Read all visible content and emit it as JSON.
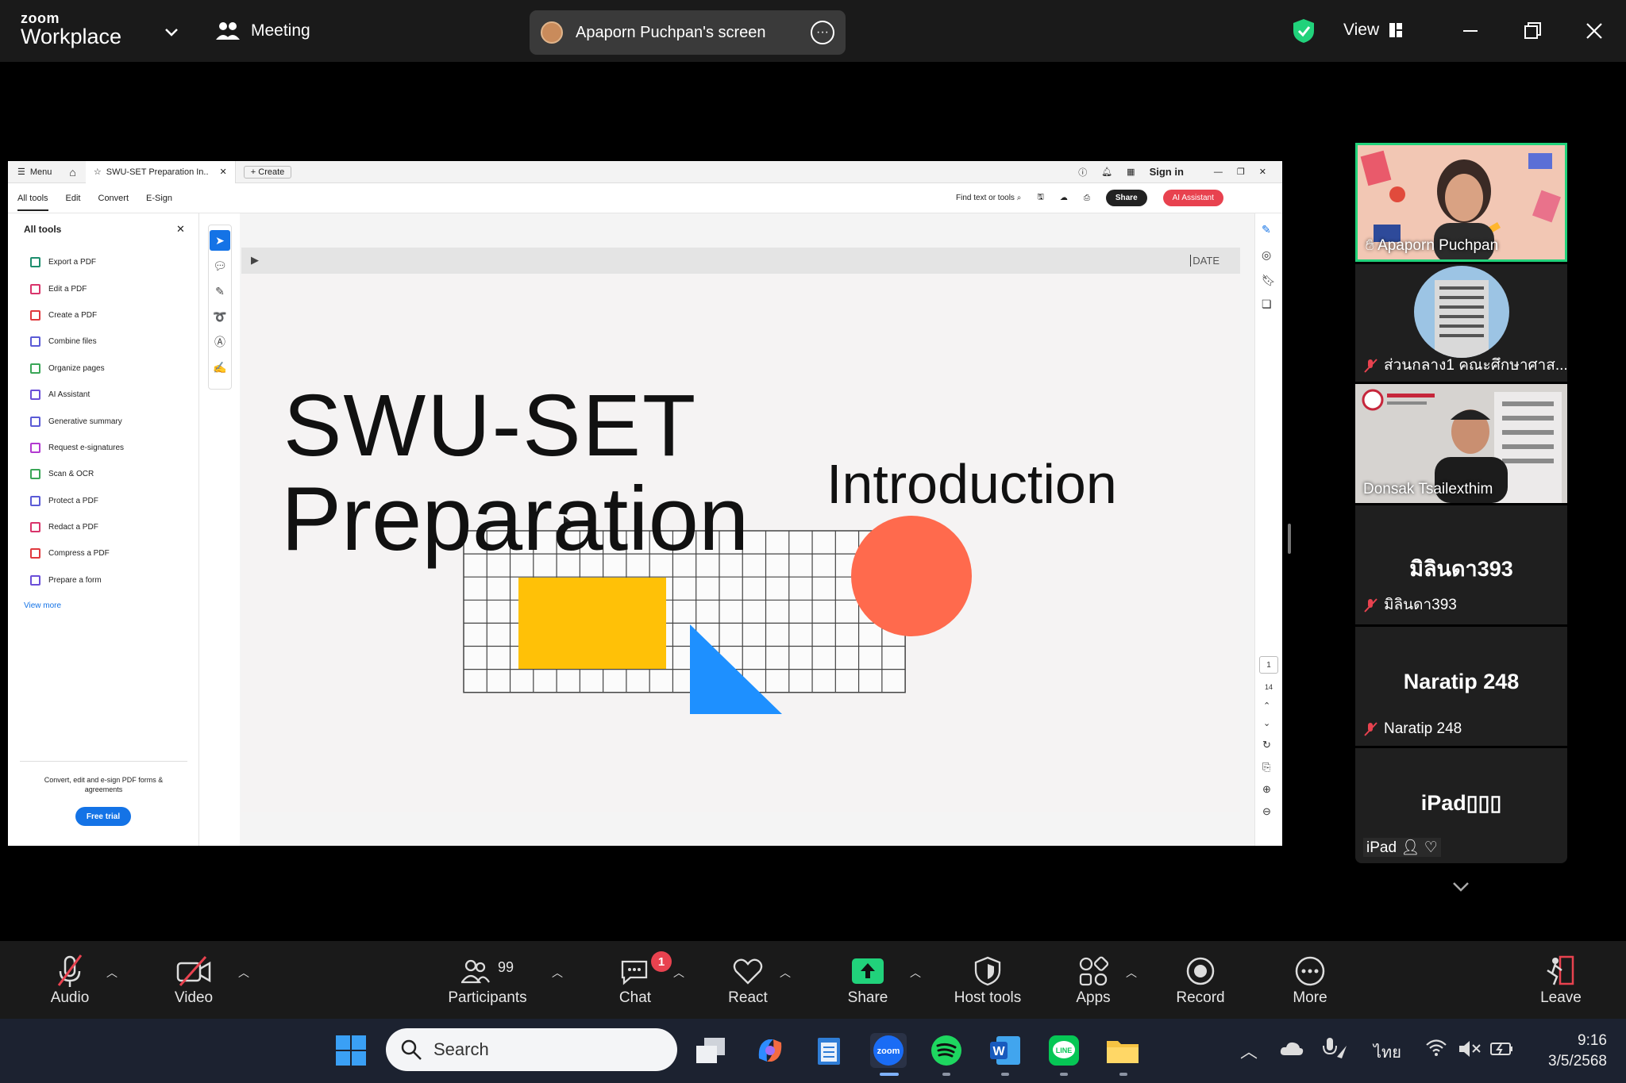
{
  "titlebar": {
    "logo_small": "zoom",
    "logo_big": "Workplace",
    "meeting_label": "Meeting",
    "share_label": "Apaporn Puchpan's screen",
    "view_label": "View"
  },
  "shared_doc": {
    "tab_menu": "Menu",
    "tab_title": "SWU-SET Preparation In..",
    "tab_create": "Create",
    "sign_in": "Sign in",
    "menu_items": [
      "All tools",
      "Edit",
      "Convert",
      "E-Sign"
    ],
    "find_placeholder": "Find text or tools",
    "share_btn": "Share",
    "ai_btn": "AI Assistant",
    "panel_title": "All tools",
    "tools": [
      {
        "label": "Export a PDF",
        "color": "#1e8e6e"
      },
      {
        "label": "Edit a PDF",
        "color": "#d9346b"
      },
      {
        "label": "Create a PDF",
        "color": "#e0393e"
      },
      {
        "label": "Combine files",
        "color": "#5b5bd6"
      },
      {
        "label": "Organize pages",
        "color": "#3aa657"
      },
      {
        "label": "AI Assistant",
        "color": "#6b4fd8"
      },
      {
        "label": "Generative summary",
        "color": "#5b5bd6"
      },
      {
        "label": "Request e-signatures",
        "color": "#b23ad0"
      },
      {
        "label": "Scan & OCR",
        "color": "#3aa657"
      },
      {
        "label": "Protect a PDF",
        "color": "#5b5bd6"
      },
      {
        "label": "Redact a PDF",
        "color": "#d9346b"
      },
      {
        "label": "Compress a PDF",
        "color": "#e0393e"
      },
      {
        "label": "Prepare a form",
        "color": "#6b4fd8"
      }
    ],
    "view_more": "View more",
    "promo_text": "Convert, edit and e-sign PDF forms & agreements",
    "free_trial": "Free trial",
    "slide_date": "DATE",
    "slide_title_1": "SWU-SET",
    "slide_title_2": "Preparation",
    "slide_subtitle": "Introduction",
    "page_current": "1",
    "page_total": "14"
  },
  "participants_panel": {
    "tiles": [
      {
        "name": "Apaporn Puchpan"
      },
      {
        "name": "ส่วนกลาง1 คณะศึกษาศาส..."
      },
      {
        "name": "Donsak Tsailexthim"
      },
      {
        "big": "มิลินดา393",
        "name": "มิลินดา393"
      },
      {
        "big": "Naratip 248",
        "name": "Naratip 248"
      },
      {
        "big": "iPad▯▯▯",
        "name": "iPad"
      }
    ]
  },
  "toolbar": {
    "audio": "Audio",
    "video": "Video",
    "participants": "Participants",
    "participants_count": "99",
    "chat": "Chat",
    "chat_badge": "1",
    "react": "React",
    "share": "Share",
    "host_tools": "Host tools",
    "apps": "Apps",
    "record": "Record",
    "more": "More",
    "leave": "Leave"
  },
  "taskbar": {
    "search_placeholder": "Search",
    "lang": "ไทย",
    "time": "9:16",
    "date": "3/5/2568"
  },
  "colors": {
    "accent_green": "#21d27b",
    "slide_yellow": "#ffc107",
    "slide_red": "#ff6a4d",
    "slide_blue": "#1e90ff",
    "ai_red": "#e8424f",
    "link_blue": "#1473e6"
  }
}
